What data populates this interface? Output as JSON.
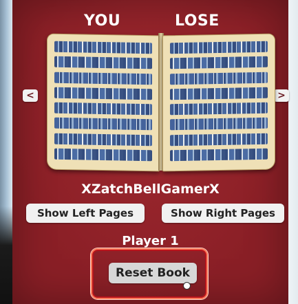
{
  "result": {
    "word1": "YOU",
    "word2": "LOSE"
  },
  "book": {
    "prev_arrow": "<",
    "next_arrow": ">"
  },
  "player": {
    "name": "XZatchBellGamerX",
    "label": "Player 1"
  },
  "buttons": {
    "show_left": "Show Left Pages",
    "show_right": "Show Right Pages",
    "reset": "Reset Book"
  },
  "colors": {
    "panel": "#8a1f26",
    "highlight_ring": "#ff7a5a",
    "page": "#efe0b6",
    "glyph_ink": "#2f4f8c"
  },
  "icons": {
    "prev": "chevron-left-icon",
    "next": "chevron-right-icon",
    "cursor": "pointer-cursor-icon"
  }
}
